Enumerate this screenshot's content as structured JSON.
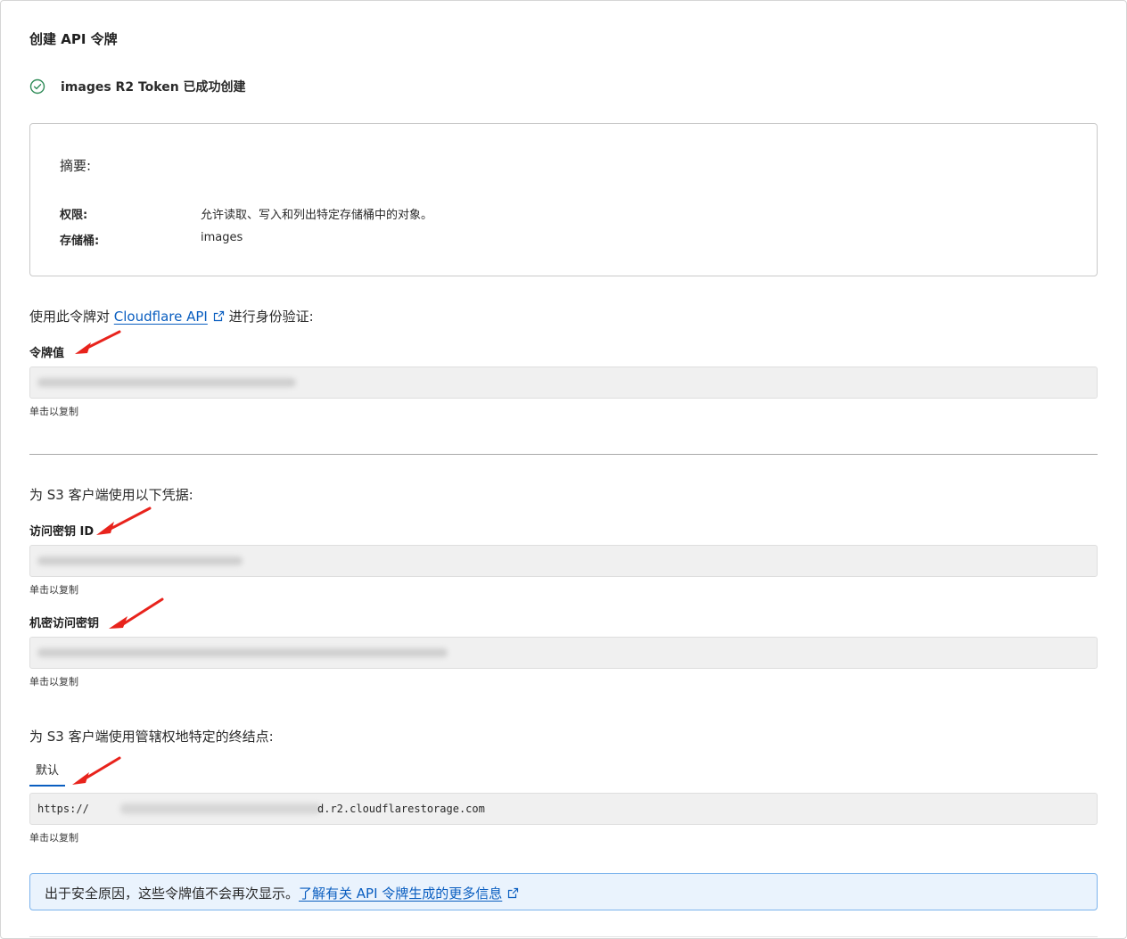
{
  "header": {
    "title": "创建 API 令牌"
  },
  "status": {
    "message": "images R2 Token 已成功创建",
    "icon": "check-circle-icon",
    "color": "#2e8b57"
  },
  "summary": {
    "title": "摘要:",
    "rows": [
      {
        "label": "权限:",
        "value": "允许读取、写入和列出特定存储桶中的对象。"
      },
      {
        "label": "存储桶:",
        "value": "images"
      }
    ]
  },
  "api_section": {
    "prefix": "使用此令牌对 ",
    "link": "Cloudflare API",
    "suffix": " 进行身份验证:",
    "token_label": "令牌值",
    "copy_hint": "单击以复制"
  },
  "s3_section": {
    "intro": "为 S3 客户端使用以下凭据:",
    "access_key_label": "访问密钥 ID",
    "access_key_hint": "单击以复制",
    "secret_label": "机密访问密钥",
    "secret_hint": "单击以复制"
  },
  "endpoint_section": {
    "intro": "为 S3 客户端使用管辖权地特定的终结点:",
    "tab_default": "默认",
    "url_prefix": "https://",
    "url_suffix": "d.r2.cloudflarestorage.com",
    "copy_hint": "单击以复制"
  },
  "notice": {
    "text": "出于安全原因，这些令牌值不会再次显示。",
    "link": "了解有关 API 令牌生成的更多信息"
  },
  "colors": {
    "link": "#0a5ec0",
    "annotation_arrow": "#e8231c",
    "info_bg": "#eaf3fd",
    "info_border": "#7bb3ec"
  }
}
